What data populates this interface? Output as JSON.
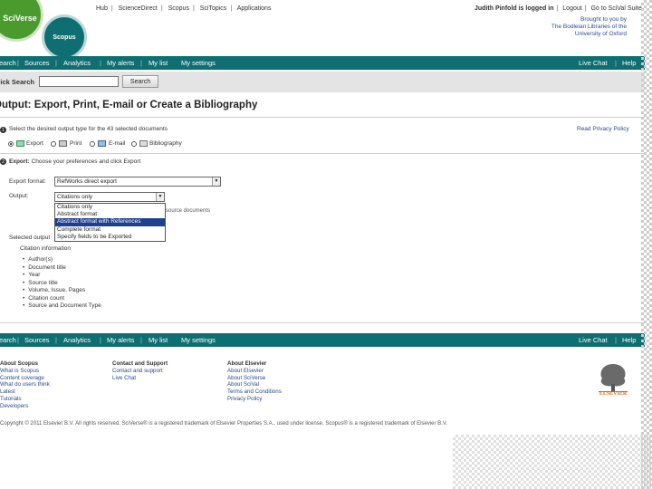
{
  "header": {
    "logo_sciverse": "SciVerse",
    "logo_scopus": "Scopus",
    "top_links": [
      "Hub",
      "ScienceDirect",
      "Scopus",
      "SciTopics",
      "Applications"
    ],
    "user_logged_in": "Judith Pinfold is logged in",
    "user_links": [
      "Logout",
      "Go to SciVal Suite"
    ],
    "brought_by": [
      "Brought to you by",
      "The Bodleian Libraries of the",
      "University of Oxford"
    ]
  },
  "nav": {
    "left": [
      "Search",
      "Sources",
      "Analytics",
      "My alerts",
      "My list",
      "My settings"
    ],
    "right": [
      "Live Chat",
      "Help"
    ]
  },
  "quicksearch": {
    "label": "Quick Search",
    "value": "",
    "button": "Search"
  },
  "page_title": "Output: Export, Print, E-mail or Create a Bibliography",
  "step1": {
    "number": "1",
    "text": "Select the desired output type for the 43 selected documents",
    "privacy": "Read Privacy Policy",
    "options": [
      {
        "label": "Export",
        "selected": true,
        "icon": "export-icon"
      },
      {
        "label": "Print",
        "selected": false,
        "icon": "print-icon"
      },
      {
        "label": "E-mail",
        "selected": false,
        "icon": "email-icon"
      },
      {
        "label": "Bibliography",
        "selected": false,
        "icon": "bibliography-icon"
      }
    ]
  },
  "step2": {
    "number": "2",
    "heading": "Export:",
    "text": "Choose your preferences and click Export",
    "export_format_label": "Export format:",
    "export_format_value": "RefWorks direct export",
    "output_label": "Output:",
    "output_value": "Citations only",
    "output_options": [
      "Citations only",
      "Abstract format",
      "Abstract format with References",
      "Complete format",
      "Specify fields to be Exported"
    ],
    "output_selected_index": 2,
    "behind_text": "source documents",
    "selected_output_label": "Selected output",
    "citation_info_label": "Citation information",
    "citation_fields": [
      "Author(s)",
      "Document title",
      "Year",
      "Source title",
      "Volume, Issue, Pages",
      "Citation count",
      "Source and Document Type"
    ]
  },
  "footer": {
    "nav_left": [
      "Search",
      "Sources",
      "Analytics",
      "My alerts",
      "My list",
      "My settings"
    ],
    "nav_right": [
      "Live Chat",
      "Help"
    ],
    "col1": {
      "heading": "About Scopus",
      "links": [
        "What is Scopus",
        "Content coverage",
        "What do users think",
        "Latest",
        "Tutorials",
        "Developers"
      ]
    },
    "col2": {
      "heading": "Contact and Support",
      "links": [
        "Contact and support",
        "Live Chat"
      ]
    },
    "col3": {
      "heading": "About Elsevier",
      "links": [
        "About Elsevier",
        "About SciVerse",
        "About SciVal",
        "Terms and Conditions",
        "Privacy Policy"
      ]
    },
    "elsevier": "ELSEVIER",
    "copyright": "Copyright © 2011 Elsevier B.V. All rights reserved. SciVerse® is a registered trademark of Elsevier Properties S.A., used under license. Scopus® is a registered trademark of Elsevier B.V."
  }
}
